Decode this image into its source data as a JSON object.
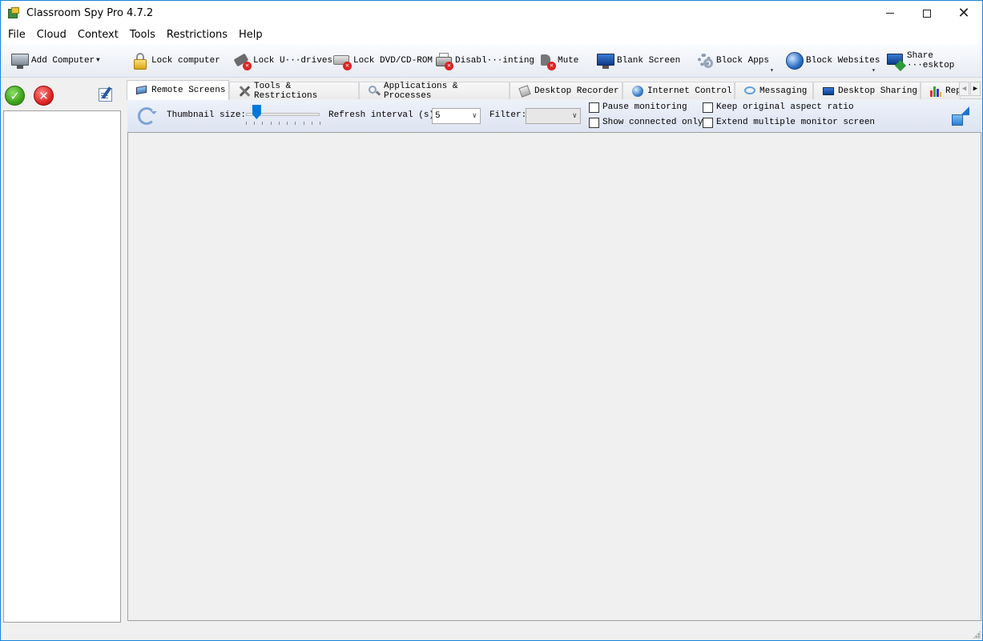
{
  "window": {
    "title": "Classroom Spy Pro 4.7.2"
  },
  "menu": [
    "File",
    "Cloud",
    "Context",
    "Tools",
    "Restrictions",
    "Help"
  ],
  "toolbar": {
    "add_computer": "Add Computer",
    "lock_computer": "Lock computer",
    "lock_usb": "Lock U···drives",
    "lock_dvd": "Lock DVD/CD-ROM",
    "disable_printing": "Disabl···inting",
    "mute": "Mute",
    "blank_screen": "Blank Screen",
    "block_apps": "Block Apps",
    "block_websites": "Block Websites",
    "share_desktop": "Share ···esktop"
  },
  "tabs": [
    {
      "label": "Remote Screens",
      "icon": "monitor-icon",
      "active": true
    },
    {
      "label": "Tools & Restrictions",
      "icon": "tools-icon"
    },
    {
      "label": "Applications & Processes",
      "icon": "magnifier-icon"
    },
    {
      "label": "Desktop Recorder",
      "icon": "recorder-icon"
    },
    {
      "label": "Internet Control",
      "icon": "globe-icon"
    },
    {
      "label": "Messaging",
      "icon": "message-icon"
    },
    {
      "label": "Desktop Sharing",
      "icon": "sharing-icon"
    },
    {
      "label": "Rep",
      "icon": "chart-icon"
    }
  ],
  "options": {
    "thumbnail_label": "Thumbnail size:",
    "thumbnail_level": 0.14,
    "refresh_label": "Refresh interval (s):",
    "refresh_value": "5",
    "filter_label": "Filter:",
    "filter_value": "",
    "pause_monitoring": {
      "label": "Pause monitoring",
      "checked": false
    },
    "show_connected_only": {
      "label": "Show connected only",
      "checked": false
    },
    "keep_aspect": {
      "label": "Keep original aspect ratio",
      "checked": false
    },
    "extend_monitor": {
      "label": "Extend multiple monitor screen",
      "checked": false
    }
  },
  "colors": {
    "accent": "#0078d7",
    "frame": "#1883d7"
  }
}
